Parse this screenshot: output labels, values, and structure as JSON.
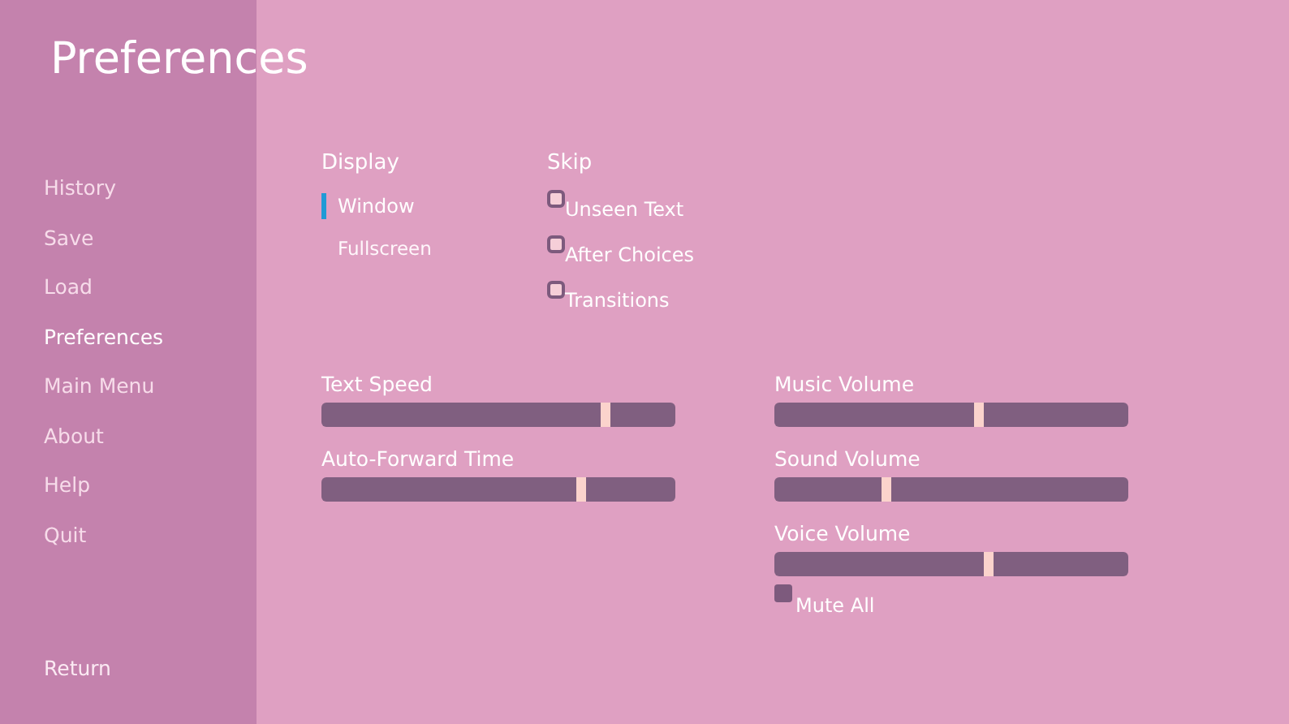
{
  "title": "Preferences",
  "nav": [
    {
      "label": "History",
      "selected": false
    },
    {
      "label": "Save",
      "selected": false
    },
    {
      "label": "Load",
      "selected": false
    },
    {
      "label": "Preferences",
      "selected": true
    },
    {
      "label": "Main Menu",
      "selected": false
    },
    {
      "label": "About",
      "selected": false
    },
    {
      "label": "Help",
      "selected": false
    },
    {
      "label": "Quit",
      "selected": false
    }
  ],
  "return_label": "Return",
  "display": {
    "heading": "Display",
    "options": [
      {
        "label": "Window",
        "selected": true
      },
      {
        "label": "Fullscreen",
        "selected": false
      }
    ]
  },
  "skip": {
    "heading": "Skip",
    "options": [
      {
        "label": "Unseen Text",
        "checked": true
      },
      {
        "label": "After Choices",
        "checked": true
      },
      {
        "label": "Transitions",
        "checked": true
      }
    ]
  },
  "left_sliders": [
    {
      "label": "Text Speed",
      "level": 0.81
    },
    {
      "label": "Auto-Forward Time",
      "level": 0.74
    }
  ],
  "right_sliders": [
    {
      "label": "Music Volume",
      "level": 0.58
    },
    {
      "label": "Sound Volume",
      "level": 0.31
    },
    {
      "label": "Voice Volume",
      "level": 0.61
    }
  ],
  "mute_all": {
    "label": "Mute All",
    "checked": false
  }
}
